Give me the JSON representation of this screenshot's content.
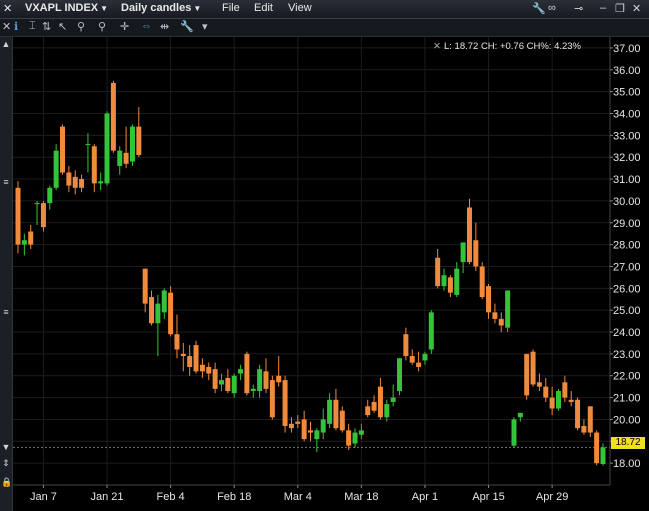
{
  "titlebar": {
    "symbol": "VXAPL INDEX",
    "period": "Daily candles",
    "menu": [
      "File",
      "Edit",
      "View"
    ]
  },
  "info": {
    "text": "L: 18.72 CH: +0.76 CH%: 4.23%"
  },
  "price_tag": "18.72",
  "colors": {
    "up": "#33c43a",
    "down": "#f08a3c",
    "background": "#000000",
    "tag": "#f0e020"
  },
  "chart_data": {
    "type": "candlestick",
    "ylim": [
      17.0,
      37.5
    ],
    "y_ticks": [
      "18.00",
      "19.00",
      "20.00",
      "21.00",
      "22.00",
      "23.00",
      "24.00",
      "25.00",
      "26.00",
      "27.00",
      "28.00",
      "29.00",
      "30.00",
      "31.00",
      "32.00",
      "33.00",
      "34.00",
      "35.00",
      "36.00",
      "37.00"
    ],
    "x_ticks": [
      "Jan 7",
      "Jan 21",
      "Feb 4",
      "Feb 18",
      "Mar 4",
      "Mar 18",
      "Apr 1",
      "Apr 15",
      "Apr 29"
    ],
    "last_price": 18.72,
    "candles": [
      {
        "o": 30.6,
        "h": 30.9,
        "l": 27.6,
        "c": 28.0
      },
      {
        "o": 28.0,
        "h": 28.5,
        "l": 27.5,
        "c": 28.2
      },
      {
        "o": 28.6,
        "h": 28.9,
        "l": 27.8,
        "c": 28.0
      },
      {
        "o": 29.9,
        "h": 30.0,
        "l": 28.9,
        "c": 29.9
      },
      {
        "o": 29.9,
        "h": 30.0,
        "l": 28.6,
        "c": 28.8
      },
      {
        "o": 29.9,
        "h": 30.7,
        "l": 29.6,
        "c": 30.6
      },
      {
        "o": 30.6,
        "h": 32.6,
        "l": 30.5,
        "c": 32.3
      },
      {
        "o": 33.4,
        "h": 33.5,
        "l": 31.2,
        "c": 31.3
      },
      {
        "o": 31.3,
        "h": 31.6,
        "l": 30.4,
        "c": 30.7
      },
      {
        "o": 31.1,
        "h": 31.4,
        "l": 30.3,
        "c": 30.6
      },
      {
        "o": 31.0,
        "h": 31.2,
        "l": 30.4,
        "c": 30.6
      },
      {
        "o": 32.6,
        "h": 33.1,
        "l": 31.3,
        "c": 32.6
      },
      {
        "o": 32.5,
        "h": 32.6,
        "l": 30.4,
        "c": 30.8
      },
      {
        "o": 30.8,
        "h": 31.3,
        "l": 30.5,
        "c": 30.9
      },
      {
        "o": 30.8,
        "h": 34.1,
        "l": 30.7,
        "c": 34.0
      },
      {
        "o": 35.4,
        "h": 35.5,
        "l": 32.2,
        "c": 32.3
      },
      {
        "o": 31.6,
        "h": 32.5,
        "l": 31.2,
        "c": 32.3
      },
      {
        "o": 32.2,
        "h": 33.4,
        "l": 31.5,
        "c": 31.7
      },
      {
        "o": 31.8,
        "h": 33.5,
        "l": 31.6,
        "c": 33.4
      },
      {
        "o": 33.4,
        "h": 34.3,
        "l": 32.0,
        "c": 32.1
      },
      {
        "o": 26.9,
        "h": 26.9,
        "l": 24.9,
        "c": 25.3
      },
      {
        "o": 25.6,
        "h": 25.9,
        "l": 24.3,
        "c": 24.4
      },
      {
        "o": 24.4,
        "h": 25.7,
        "l": 22.9,
        "c": 25.3
      },
      {
        "o": 24.9,
        "h": 26.0,
        "l": 24.6,
        "c": 25.9
      },
      {
        "o": 25.8,
        "h": 26.1,
        "l": 23.8,
        "c": 23.9
      },
      {
        "o": 23.9,
        "h": 24.8,
        "l": 22.8,
        "c": 23.2
      },
      {
        "o": 23.0,
        "h": 23.5,
        "l": 22.2,
        "c": 22.9
      },
      {
        "o": 22.9,
        "h": 23.4,
        "l": 22.0,
        "c": 22.4
      },
      {
        "o": 23.4,
        "h": 23.6,
        "l": 22.1,
        "c": 22.2
      },
      {
        "o": 22.5,
        "h": 22.8,
        "l": 21.9,
        "c": 22.2
      },
      {
        "o": 22.4,
        "h": 22.6,
        "l": 21.8,
        "c": 22.1
      },
      {
        "o": 22.3,
        "h": 22.6,
        "l": 21.2,
        "c": 21.4
      },
      {
        "o": 21.6,
        "h": 22.1,
        "l": 21.3,
        "c": 21.8
      },
      {
        "o": 21.9,
        "h": 22.3,
        "l": 21.2,
        "c": 21.3
      },
      {
        "o": 21.2,
        "h": 22.1,
        "l": 21.0,
        "c": 22.0
      },
      {
        "o": 22.1,
        "h": 22.5,
        "l": 21.8,
        "c": 22.3
      },
      {
        "o": 23.0,
        "h": 23.1,
        "l": 21.1,
        "c": 21.2
      },
      {
        "o": 21.3,
        "h": 21.6,
        "l": 21.0,
        "c": 21.4
      },
      {
        "o": 21.3,
        "h": 22.5,
        "l": 21.0,
        "c": 22.3
      },
      {
        "o": 22.2,
        "h": 22.8,
        "l": 21.2,
        "c": 21.4
      },
      {
        "o": 21.8,
        "h": 22.0,
        "l": 20.0,
        "c": 20.1
      },
      {
        "o": 22.0,
        "h": 22.9,
        "l": 21.5,
        "c": 21.7
      },
      {
        "o": 21.8,
        "h": 22.0,
        "l": 19.4,
        "c": 19.7
      },
      {
        "o": 19.8,
        "h": 20.1,
        "l": 19.4,
        "c": 19.6
      },
      {
        "o": 19.9,
        "h": 20.2,
        "l": 19.6,
        "c": 19.8
      },
      {
        "o": 20.0,
        "h": 20.4,
        "l": 19.0,
        "c": 19.1
      },
      {
        "o": 19.5,
        "h": 19.9,
        "l": 19.0,
        "c": 19.4
      },
      {
        "o": 19.1,
        "h": 19.6,
        "l": 18.5,
        "c": 19.5
      },
      {
        "o": 19.4,
        "h": 20.5,
        "l": 19.1,
        "c": 20.0
      },
      {
        "o": 19.8,
        "h": 21.2,
        "l": 19.6,
        "c": 20.9
      },
      {
        "o": 20.9,
        "h": 21.4,
        "l": 19.5,
        "c": 19.6
      },
      {
        "o": 20.4,
        "h": 20.6,
        "l": 19.4,
        "c": 19.5
      },
      {
        "o": 19.5,
        "h": 19.8,
        "l": 18.6,
        "c": 18.8
      },
      {
        "o": 18.9,
        "h": 19.6,
        "l": 18.7,
        "c": 19.4
      },
      {
        "o": 19.3,
        "h": 19.8,
        "l": 19.1,
        "c": 19.5
      },
      {
        "o": 20.6,
        "h": 20.9,
        "l": 20.1,
        "c": 20.2
      },
      {
        "o": 20.8,
        "h": 21.1,
        "l": 20.3,
        "c": 20.4
      },
      {
        "o": 21.5,
        "h": 21.9,
        "l": 20.0,
        "c": 20.1
      },
      {
        "o": 20.1,
        "h": 20.9,
        "l": 19.9,
        "c": 20.7
      },
      {
        "o": 20.8,
        "h": 21.6,
        "l": 20.6,
        "c": 21.0
      },
      {
        "o": 21.3,
        "h": 22.8,
        "l": 21.1,
        "c": 22.8
      },
      {
        "o": 23.9,
        "h": 24.2,
        "l": 22.7,
        "c": 22.9
      },
      {
        "o": 22.9,
        "h": 23.2,
        "l": 22.5,
        "c": 22.6
      },
      {
        "o": 22.6,
        "h": 23.1,
        "l": 22.2,
        "c": 22.4
      },
      {
        "o": 22.7,
        "h": 23.1,
        "l": 22.5,
        "c": 23.0
      },
      {
        "o": 23.2,
        "h": 25.0,
        "l": 23.0,
        "c": 24.9
      },
      {
        "o": 27.4,
        "h": 27.8,
        "l": 26.0,
        "c": 26.1
      },
      {
        "o": 26.1,
        "h": 26.9,
        "l": 25.9,
        "c": 26.6
      },
      {
        "o": 26.5,
        "h": 26.6,
        "l": 25.6,
        "c": 25.8
      },
      {
        "o": 25.7,
        "h": 27.2,
        "l": 25.6,
        "c": 26.9
      },
      {
        "o": 27.2,
        "h": 28.1,
        "l": 26.7,
        "c": 28.1
      },
      {
        "o": 29.7,
        "h": 30.1,
        "l": 27.1,
        "c": 27.2
      },
      {
        "o": 28.2,
        "h": 29.0,
        "l": 26.8,
        "c": 27.0
      },
      {
        "o": 27.0,
        "h": 27.2,
        "l": 25.5,
        "c": 25.6
      },
      {
        "o": 26.1,
        "h": 26.2,
        "l": 24.6,
        "c": 24.9
      },
      {
        "o": 24.9,
        "h": 25.3,
        "l": 24.4,
        "c": 24.6
      },
      {
        "o": 24.6,
        "h": 24.9,
        "l": 24.0,
        "c": 24.3
      },
      {
        "o": 24.2,
        "h": 25.9,
        "l": 24.0,
        "c": 25.9
      },
      {
        "o": 18.8,
        "h": 20.1,
        "l": 18.7,
        "c": 20.0
      },
      {
        "o": 20.1,
        "h": 20.3,
        "l": 19.9,
        "c": 20.3
      },
      {
        "o": 23.0,
        "h": 23.0,
        "l": 20.9,
        "c": 21.1
      },
      {
        "o": 23.1,
        "h": 23.2,
        "l": 21.5,
        "c": 21.6
      },
      {
        "o": 21.7,
        "h": 22.1,
        "l": 21.3,
        "c": 21.5
      },
      {
        "o": 21.5,
        "h": 21.9,
        "l": 20.8,
        "c": 21.0
      },
      {
        "o": 21.0,
        "h": 21.5,
        "l": 20.2,
        "c": 20.5
      },
      {
        "o": 20.5,
        "h": 21.4,
        "l": 20.4,
        "c": 21.3
      },
      {
        "o": 21.7,
        "h": 22.0,
        "l": 20.8,
        "c": 21.0
      },
      {
        "o": 20.9,
        "h": 21.3,
        "l": 20.6,
        "c": 20.8
      },
      {
        "o": 20.9,
        "h": 21.0,
        "l": 19.5,
        "c": 19.6
      },
      {
        "o": 19.7,
        "h": 20.0,
        "l": 19.3,
        "c": 19.4
      },
      {
        "o": 20.6,
        "h": 20.6,
        "l": 19.2,
        "c": 19.4
      },
      {
        "o": 19.4,
        "h": 19.5,
        "l": 17.9,
        "c": 18.0
      },
      {
        "o": 17.96,
        "h": 18.9,
        "l": 17.9,
        "c": 18.72
      }
    ]
  }
}
